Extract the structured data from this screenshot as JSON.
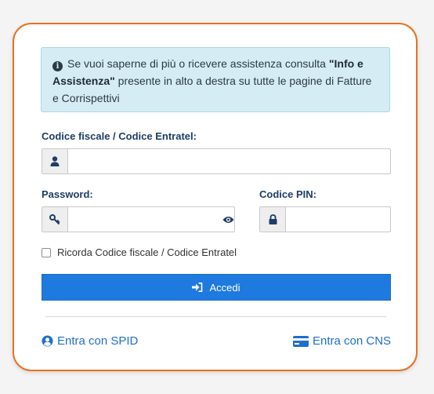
{
  "info_box": {
    "text_before": "Se vuoi saperne di più o ricevere assistenza consulta ",
    "text_bold": "\"Info e Assistenza\"",
    "text_after": " presente in alto a destra su tutte le pagine di Fatture e Corrispettivi"
  },
  "fields": {
    "codice_fiscale_label": "Codice fiscale / Codice Entratel:",
    "codice_fiscale_value": "",
    "password_label": "Password:",
    "password_value": "",
    "pin_label": "Codice PIN:",
    "pin_value": ""
  },
  "remember": {
    "label": "Ricorda Codice fiscale / Codice Entratel",
    "checked": false
  },
  "login_button": {
    "label": "Accedi"
  },
  "links": {
    "spid": "Entra con SPID",
    "cns": "Entra con CNS"
  },
  "colors": {
    "accent": "#e8711f",
    "primary": "#1f7ae0",
    "link": "#1f6fc9",
    "info_bg": "#d6ecf4"
  }
}
